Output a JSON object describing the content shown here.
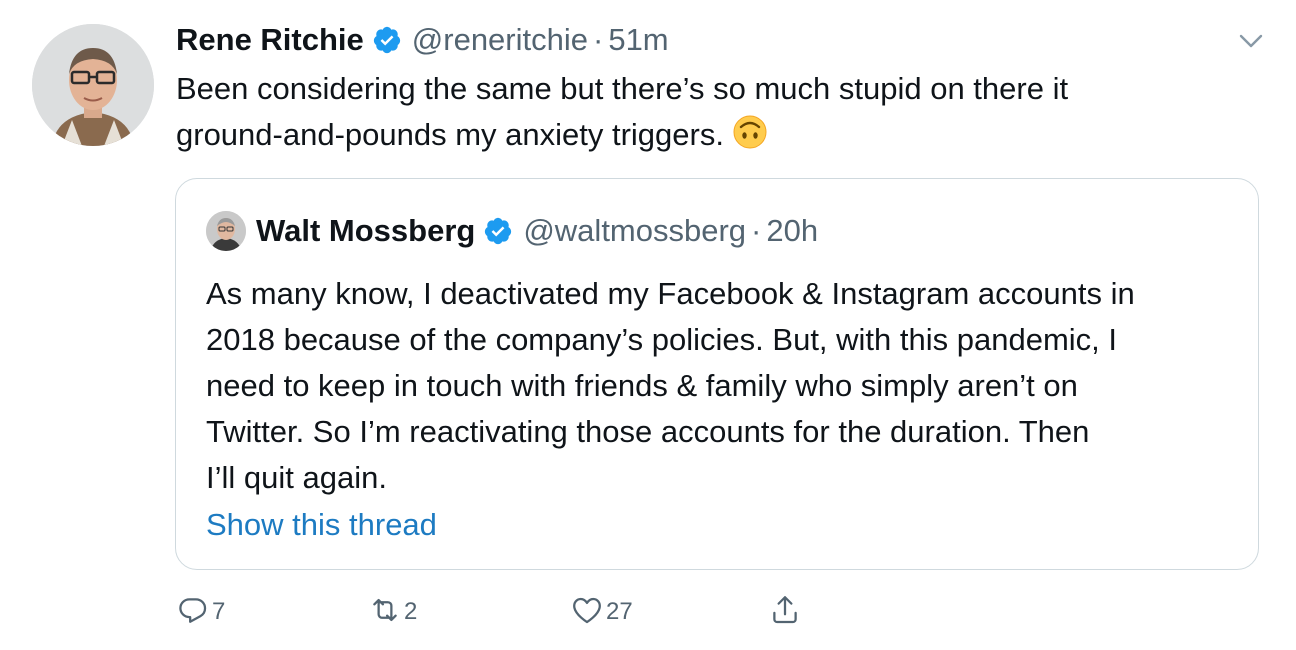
{
  "tweet": {
    "author": {
      "name": "Rene Ritchie",
      "handle": "@reneritchie",
      "separator": "·",
      "time": "51m"
    },
    "text_lines": [
      "Been considering the same but there’s so much stupid on there it",
      "ground-and-pounds my anxiety triggers."
    ],
    "emoji": "upside-down-face-emoji",
    "menu_icon": "chevron-down-icon"
  },
  "quote": {
    "author": {
      "name": "Walt Mossberg",
      "handle": "@waltmossberg",
      "separator": "·",
      "time": "20h"
    },
    "text_lines": [
      "As many know, I deactivated my Facebook & Instagram accounts in",
      "2018 because of the company’s policies. But, with this pandemic, I",
      "need to keep in touch with friends & family who simply aren’t on",
      "Twitter. So I’m reactivating those accounts for the duration. Then",
      "I’ll quit again."
    ],
    "show_thread": "Show this thread"
  },
  "actions": {
    "reply": {
      "icon": "reply-icon",
      "count": "7"
    },
    "retweet": {
      "icon": "retweet-icon",
      "count": "2"
    },
    "like": {
      "icon": "heart-icon",
      "count": "27"
    },
    "share": {
      "icon": "share-icon",
      "count": ""
    }
  },
  "colors": {
    "text": "#0f1419",
    "secondary": "#536471",
    "link": "#1d7bc2",
    "verified": "#1d9bf0",
    "border": "#cfd9de"
  }
}
